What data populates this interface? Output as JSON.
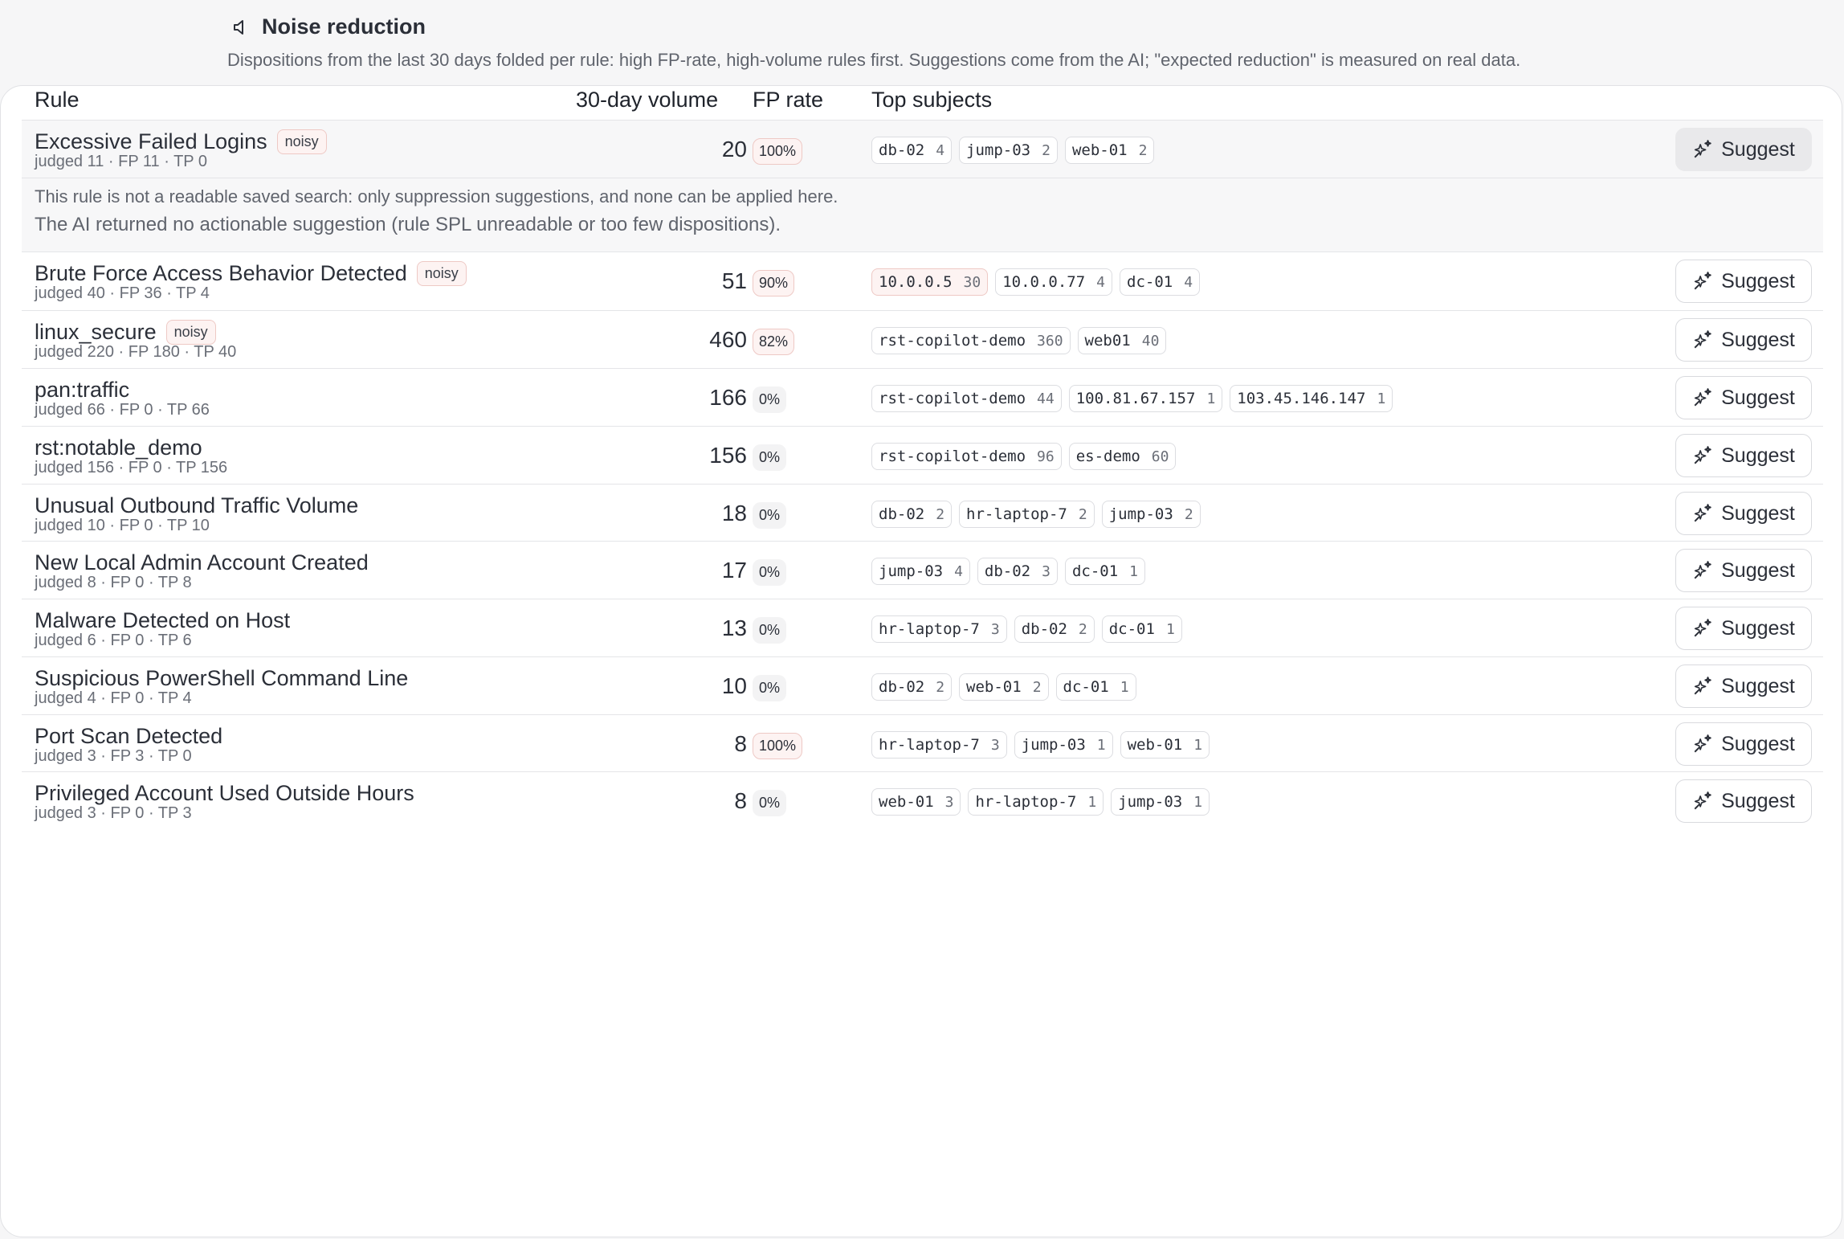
{
  "header": {
    "title": "Noise reduction",
    "subtitle": "Dispositions from the last 30 days folded per rule: high FP-rate, high-volume rules first. Suggestions come from the AI; \"expected reduction\" is measured on real data.",
    "icon": "speaker-icon"
  },
  "table": {
    "columns": {
      "rule": "Rule",
      "volume": "30-day volume",
      "fp": "FP rate",
      "subjects": "Top subjects"
    },
    "suggest_label": "Suggest",
    "noisy_label": "noisy",
    "expanded": {
      "line1": "This rule is not a readable saved search: only suppression suggestions, and none can be applied here.",
      "line2": "The AI returned no actionable suggestion (rule SPL unreadable or too few dispositions)."
    },
    "rows": [
      {
        "name": "Excessive Failed Logins",
        "noisy": true,
        "judged": "judged 11 · FP 11 · TP 0",
        "volume": "20",
        "fp": "100%",
        "fp_high": true,
        "subjects": [
          {
            "v": "db-02",
            "c": "4"
          },
          {
            "v": "jump-03",
            "c": "2"
          },
          {
            "v": "web-01",
            "c": "2"
          }
        ]
      },
      {
        "name": "Brute Force Access Behavior Detected",
        "noisy": true,
        "judged": "judged 40 · FP 36 · TP 4",
        "volume": "51",
        "fp": "90%",
        "fp_high": true,
        "subjects": [
          {
            "v": "10.0.0.5",
            "c": "30",
            "hot": true
          },
          {
            "v": "10.0.0.77",
            "c": "4"
          },
          {
            "v": "dc-01",
            "c": "4"
          }
        ]
      },
      {
        "name": "linux_secure",
        "noisy": true,
        "judged": "judged 220 · FP 180 · TP 40",
        "volume": "460",
        "fp": "82%",
        "fp_high": true,
        "subjects": [
          {
            "v": "rst-copilot-demo",
            "c": "360"
          },
          {
            "v": "web01",
            "c": "40"
          }
        ]
      },
      {
        "name": "pan:traffic",
        "noisy": false,
        "judged": "judged 66 · FP 0 · TP 66",
        "volume": "166",
        "fp": "0%",
        "fp_high": false,
        "subjects": [
          {
            "v": "rst-copilot-demo",
            "c": "44"
          },
          {
            "v": "100.81.67.157",
            "c": "1"
          },
          {
            "v": "103.45.146.147",
            "c": "1"
          }
        ]
      },
      {
        "name": "rst:notable_demo",
        "noisy": false,
        "judged": "judged 156 · FP 0 · TP 156",
        "volume": "156",
        "fp": "0%",
        "fp_high": false,
        "subjects": [
          {
            "v": "rst-copilot-demo",
            "c": "96"
          },
          {
            "v": "es-demo",
            "c": "60"
          }
        ]
      },
      {
        "name": "Unusual Outbound Traffic Volume",
        "noisy": false,
        "judged": "judged 10 · FP 0 · TP 10",
        "volume": "18",
        "fp": "0%",
        "fp_high": false,
        "subjects": [
          {
            "v": "db-02",
            "c": "2"
          },
          {
            "v": "hr-laptop-7",
            "c": "2"
          },
          {
            "v": "jump-03",
            "c": "2"
          }
        ]
      },
      {
        "name": "New Local Admin Account Created",
        "noisy": false,
        "judged": "judged 8 · FP 0 · TP 8",
        "volume": "17",
        "fp": "0%",
        "fp_high": false,
        "subjects": [
          {
            "v": "jump-03",
            "c": "4"
          },
          {
            "v": "db-02",
            "c": "3"
          },
          {
            "v": "dc-01",
            "c": "1"
          }
        ]
      },
      {
        "name": "Malware Detected on Host",
        "noisy": false,
        "judged": "judged 6 · FP 0 · TP 6",
        "volume": "13",
        "fp": "0%",
        "fp_high": false,
        "subjects": [
          {
            "v": "hr-laptop-7",
            "c": "3"
          },
          {
            "v": "db-02",
            "c": "2"
          },
          {
            "v": "dc-01",
            "c": "1"
          }
        ]
      },
      {
        "name": "Suspicious PowerShell Command Line",
        "noisy": false,
        "judged": "judged 4 · FP 0 · TP 4",
        "volume": "10",
        "fp": "0%",
        "fp_high": false,
        "subjects": [
          {
            "v": "db-02",
            "c": "2"
          },
          {
            "v": "web-01",
            "c": "2"
          },
          {
            "v": "dc-01",
            "c": "1"
          }
        ]
      },
      {
        "name": "Port Scan Detected",
        "noisy": false,
        "judged": "judged 3 · FP 3 · TP 0",
        "volume": "8",
        "fp": "100%",
        "fp_high": true,
        "subjects": [
          {
            "v": "hr-laptop-7",
            "c": "3"
          },
          {
            "v": "jump-03",
            "c": "1"
          },
          {
            "v": "web-01",
            "c": "1"
          }
        ]
      },
      {
        "name": "Privileged Account Used Outside Hours",
        "noisy": false,
        "judged": "judged 3 · FP 0 · TP 3",
        "volume": "8",
        "fp": "0%",
        "fp_high": false,
        "subjects": [
          {
            "v": "web-01",
            "c": "3"
          },
          {
            "v": "hr-laptop-7",
            "c": "1"
          },
          {
            "v": "jump-03",
            "c": "1"
          }
        ]
      }
    ]
  }
}
